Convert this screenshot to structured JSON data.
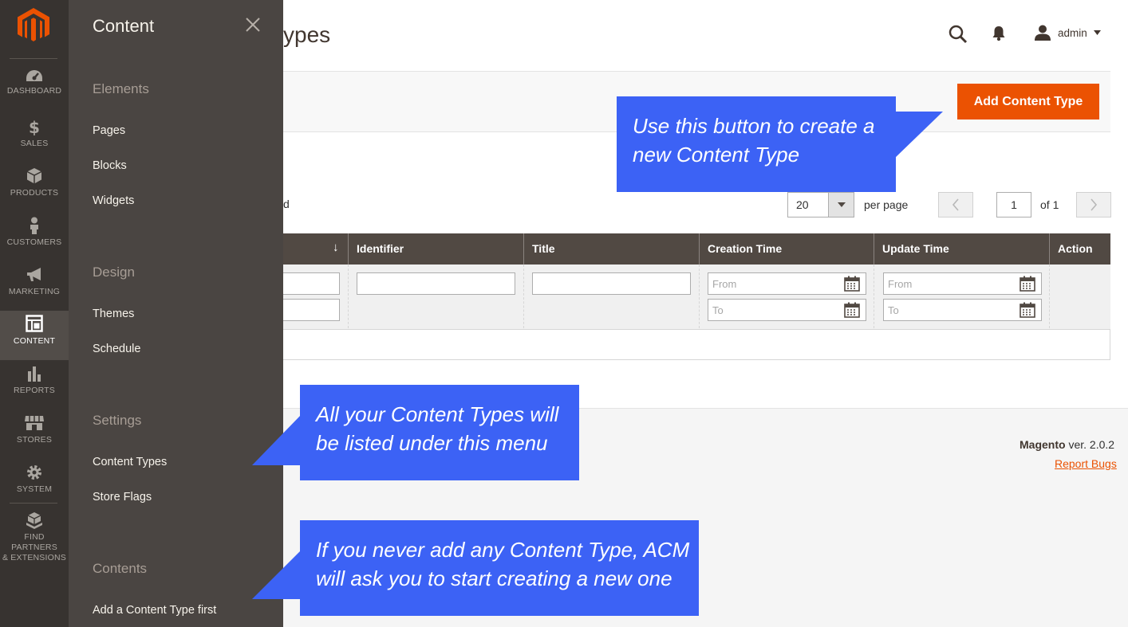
{
  "nav": {
    "items": [
      {
        "label": "DASHBOARD",
        "icon": "dashboard-icon"
      },
      {
        "label": "SALES",
        "icon": "dollar-icon"
      },
      {
        "label": "PRODUCTS",
        "icon": "cube-icon"
      },
      {
        "label": "CUSTOMERS",
        "icon": "person-icon"
      },
      {
        "label": "MARKETING",
        "icon": "megaphone-icon"
      },
      {
        "label": "CONTENT",
        "icon": "layout-icon"
      },
      {
        "label": "REPORTS",
        "icon": "bar-chart-icon"
      },
      {
        "label": "STORES",
        "icon": "storefront-icon"
      },
      {
        "label": "SYSTEM",
        "icon": "gear-icon"
      },
      {
        "label": "FIND PARTNERS\n& EXTENSIONS",
        "icon": "boxes-icon"
      }
    ],
    "active": "CONTENT"
  },
  "submenu": {
    "title": "Content",
    "groups": [
      {
        "title": "Elements",
        "items": [
          "Pages",
          "Blocks",
          "Widgets"
        ]
      },
      {
        "title": "Design",
        "items": [
          "Themes",
          "Schedule"
        ]
      },
      {
        "title": "Settings",
        "items": [
          "Content Types",
          "Store Flags"
        ]
      },
      {
        "title": "Contents",
        "items": [
          "Add a Content Type first"
        ]
      }
    ]
  },
  "header": {
    "page_title": "ypes",
    "user": "admin"
  },
  "actions": {
    "add_label": "Add Content Type"
  },
  "toolbar": {
    "records_tail": "d",
    "per_page_value": "20",
    "per_page_label": "per page",
    "page_value": "1",
    "page_of": "of 1"
  },
  "grid": {
    "columns": [
      "",
      "Identifier",
      "Title",
      "Creation Time",
      "Update Time",
      "Action"
    ],
    "sort_arrow": "↓",
    "placeholders": {
      "from": "From",
      "to": "To"
    }
  },
  "footer": {
    "brand": "Magento",
    "version": " ver. 2.0.2",
    "report_bugs": "Report Bugs"
  },
  "callouts": {
    "add_button": "Use this button to create a\nnew Content Type",
    "menu": "All your Content Types will\nbe listed under this menu",
    "empty": "If you never add any Content Type, ACM\nwill ask you to start creating a new one"
  },
  "colors": {
    "accent": "#eb5202",
    "nav_bg": "#373330",
    "submenu_bg": "#4a4542",
    "grid_header": "#514943",
    "callout": "#3c62f5"
  }
}
